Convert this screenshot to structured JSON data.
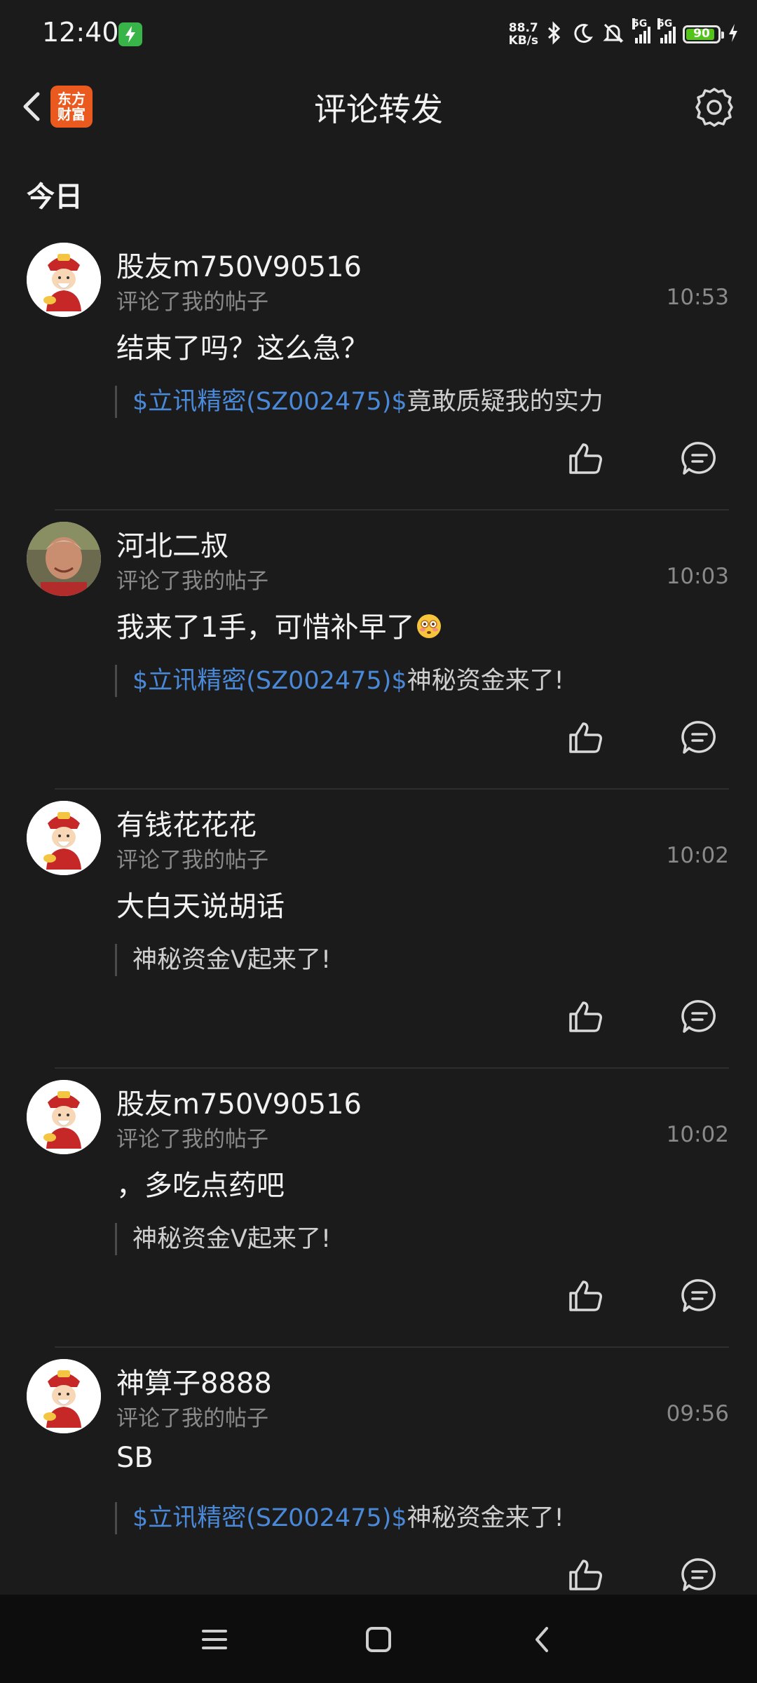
{
  "status_bar": {
    "time": "12:40",
    "net_speed_value": "88.7",
    "net_speed_unit": "KB/s",
    "sim1": "5G",
    "sim2": "5G",
    "battery": "90",
    "battery_fraction": 0.9,
    "icons": [
      "charging-icon",
      "bluetooth-icon",
      "moon-icon",
      "mute-icon",
      "signal-icon",
      "battery-icon",
      "bolt-icon"
    ]
  },
  "header": {
    "title": "评论转发",
    "app_logo_line1": "东方",
    "app_logo_line2": "财富",
    "back_icon": "chevron-left-icon",
    "settings_icon": "gear-icon"
  },
  "section_label": "今日",
  "colors": {
    "background": "#1b1b1b",
    "stock_link": "#4a88d8",
    "muted": "#8a8a8a",
    "logo": "#ea5a1e"
  },
  "comments": [
    {
      "user": "股友m750V90516",
      "action": "评论了我的帖子",
      "time": "10:53",
      "text": "结束了吗？这么急？",
      "quote_stock": "$立讯精密(SZ002475)$",
      "quote_text": "竟敢质疑我的实力",
      "avatar": "caishen"
    },
    {
      "user": "河北二叔",
      "action": "评论了我的帖子",
      "time": "10:03",
      "text": "我来了1手，可惜补早了",
      "quote_stock": "$立讯精密(SZ002475)$",
      "quote_text": "神秘资金来了!",
      "avatar": "photo"
    },
    {
      "user": "有钱花花花",
      "action": "评论了我的帖子",
      "time": "10:02",
      "text": "大白天说胡话",
      "quote_stock": "",
      "quote_text": "神秘资金Ⅴ起来了!",
      "avatar": "caishen"
    },
    {
      "user": "股友m750V90516",
      "action": "评论了我的帖子",
      "time": "10:02",
      "text": "，多吃点药吧",
      "quote_stock": "",
      "quote_text": "神秘资金Ⅴ起来了!",
      "avatar": "caishen"
    },
    {
      "user": "神算子8888",
      "action": "评论了我的帖子",
      "time": "09:56",
      "text": "SB",
      "quote_stock": "$立讯精密(SZ002475)$",
      "quote_text": "神秘资金来了!",
      "avatar": "caishen"
    }
  ],
  "nav_bar": {
    "icons": [
      "menu-icon",
      "home-icon",
      "back-icon"
    ]
  }
}
